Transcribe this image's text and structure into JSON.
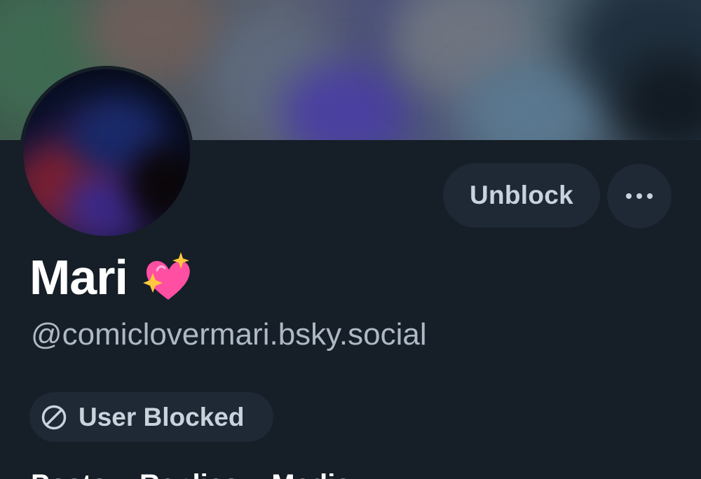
{
  "profile": {
    "display_name": "Mari",
    "name_emoji": "sparkling-heart-emoji",
    "handle": "@comiclovermari.bsky.social"
  },
  "actions": {
    "unblock_label": "Unblock",
    "more_icon": "more-horizontal-icon"
  },
  "status": {
    "blocked_label": "User Blocked",
    "blocked_icon": "blocked-circle-icon"
  },
  "tabs": [
    {
      "label": "Posts"
    },
    {
      "label": "Replies"
    },
    {
      "label": "Media"
    }
  ],
  "colors": {
    "background": "#161e27",
    "button_bg": "#1e2935",
    "button_text": "#c9d3de",
    "handle_text": "#aeb9c6",
    "name_text": "#ffffff",
    "emoji_heart": "#ff4fa3",
    "emoji_sparkle": "#ffc83d"
  }
}
